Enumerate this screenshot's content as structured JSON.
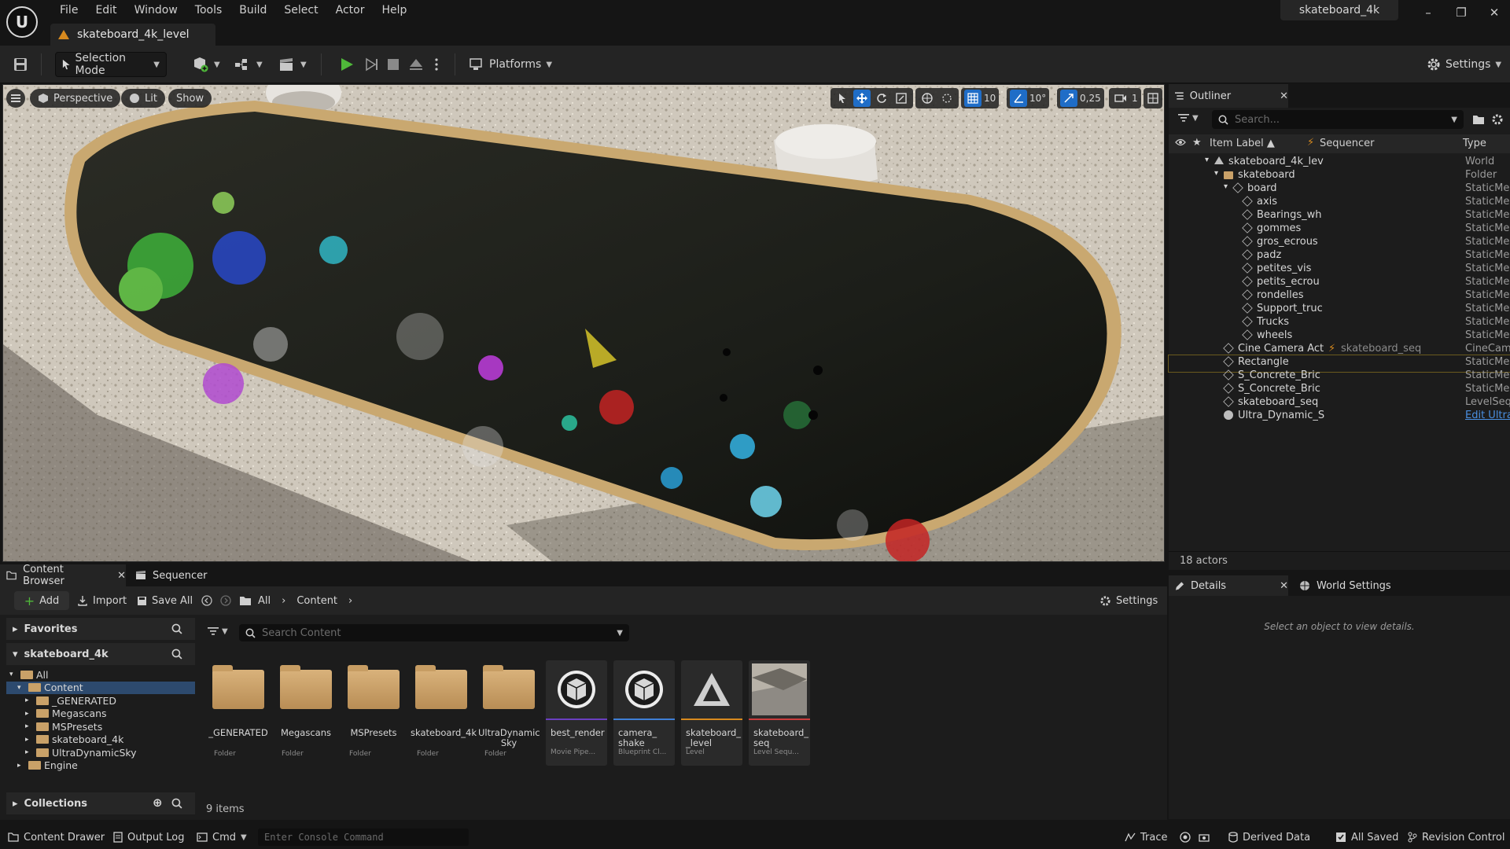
{
  "app": {
    "logo_letter": "U"
  },
  "menu": [
    "File",
    "Edit",
    "Window",
    "Tools",
    "Build",
    "Select",
    "Actor",
    "Help"
  ],
  "level_tab": "skateboard_4k_level",
  "project_name": "skateboard_4k",
  "window_controls": {
    "minimize": "–",
    "restore": "❐",
    "close": "✕"
  },
  "toolbar": {
    "selection_mode": "Selection Mode",
    "platforms": "Platforms",
    "settings": "Settings"
  },
  "viewport": {
    "perspective": "Perspective",
    "lit": "Lit",
    "show": "Show",
    "grid_snap": "10",
    "rotation_snap": "10°",
    "scale_snap": "0,25",
    "camera_speed": "1"
  },
  "outliner": {
    "tab": "Outliner",
    "search_placeholder": "Search...",
    "columns": {
      "label": "Item Label ▲",
      "sequencer": "Sequencer",
      "type": "Type"
    },
    "rows": [
      {
        "label": "skateboard_4k_lev",
        "type": "World",
        "depth": 0,
        "icon": "world"
      },
      {
        "label": "skateboard",
        "type": "Folder",
        "depth": 1,
        "icon": "folder"
      },
      {
        "label": "board",
        "type": "StaticMe",
        "depth": 2,
        "icon": "mesh"
      },
      {
        "label": "axis",
        "type": "StaticMe",
        "depth": 3,
        "icon": "mesh"
      },
      {
        "label": "Bearings_wh",
        "type": "StaticMe",
        "depth": 3,
        "icon": "mesh"
      },
      {
        "label": "gommes",
        "type": "StaticMe",
        "depth": 3,
        "icon": "mesh"
      },
      {
        "label": "gros_ecrous",
        "type": "StaticMe",
        "depth": 3,
        "icon": "mesh"
      },
      {
        "label": "padz",
        "type": "StaticMe",
        "depth": 3,
        "icon": "mesh"
      },
      {
        "label": "petites_vis",
        "type": "StaticMe",
        "depth": 3,
        "icon": "mesh"
      },
      {
        "label": "petits_ecrou",
        "type": "StaticMe",
        "depth": 3,
        "icon": "mesh"
      },
      {
        "label": "rondelles",
        "type": "StaticMe",
        "depth": 3,
        "icon": "mesh"
      },
      {
        "label": "Support_truc",
        "type": "StaticMe",
        "depth": 3,
        "icon": "mesh"
      },
      {
        "label": "Trucks",
        "type": "StaticMe",
        "depth": 3,
        "icon": "mesh"
      },
      {
        "label": "wheels",
        "type": "StaticMe",
        "depth": 3,
        "icon": "mesh"
      },
      {
        "label": "Cine Camera Act",
        "sequencer": "skateboard_seq",
        "type": "CineCam",
        "depth": 1,
        "icon": "camera"
      },
      {
        "label": "Rectangle",
        "type": "StaticMe",
        "depth": 1,
        "icon": "mesh",
        "selected": true
      },
      {
        "label": "S_Concrete_Bric",
        "type": "StaticMe",
        "depth": 1,
        "icon": "mesh"
      },
      {
        "label": "S_Concrete_Bric",
        "type": "StaticMe",
        "depth": 1,
        "icon": "mesh"
      },
      {
        "label": "skateboard_seq",
        "type": "LevelSeq",
        "depth": 1,
        "icon": "seq"
      },
      {
        "label": "Ultra_Dynamic_S",
        "type": "Edit Ultra",
        "depth": 1,
        "icon": "sky",
        "type_link": true
      }
    ],
    "actor_count": "18 actors"
  },
  "details": {
    "tab": "Details",
    "world_settings_tab": "World Settings",
    "empty_text": "Select an object to view details."
  },
  "content_browser": {
    "tab": "Content Browser",
    "sequencer_tab": "Sequencer",
    "add": "Add",
    "import": "Import",
    "save_all": "Save All",
    "breadcrumb": [
      "All",
      "Content"
    ],
    "settings": "Settings",
    "favorites": "Favorites",
    "project_root": "skateboard_4k",
    "tree": [
      {
        "label": "All",
        "depth": 0,
        "expanded": true
      },
      {
        "label": "Content",
        "depth": 1,
        "expanded": true,
        "selected": true
      },
      {
        "label": "_GENERATED",
        "depth": 2
      },
      {
        "label": "Megascans",
        "depth": 2
      },
      {
        "label": "MSPresets",
        "depth": 2
      },
      {
        "label": "skateboard_4k",
        "depth": 2
      },
      {
        "label": "UltraDynamicSky",
        "depth": 2
      },
      {
        "label": "Engine",
        "depth": 1
      }
    ],
    "collections": "Collections",
    "search_placeholder": "Search Content",
    "assets": [
      {
        "name": "_GENERATED",
        "kind": "Folder",
        "folder": true
      },
      {
        "name": "Megascans",
        "kind": "Folder",
        "folder": true
      },
      {
        "name": "MSPresets",
        "kind": "Folder",
        "folder": true
      },
      {
        "name": "skateboard_4k",
        "kind": "Folder",
        "folder": true
      },
      {
        "name": "UltraDynamic Sky",
        "kind": "Folder",
        "folder": true
      },
      {
        "name": "best_render",
        "kind": "Movie Pipe...",
        "bar": "#6a3fc0"
      },
      {
        "name": "camera_ shake",
        "kind": "Blueprint Cl...",
        "bar": "#3f7fd6"
      },
      {
        "name": "skateboard_ _level",
        "kind": "Level",
        "bar": "#d88a1e"
      },
      {
        "name": "skateboard_ seq",
        "kind": "Level Sequ...",
        "bar": "#c83d3d"
      }
    ],
    "item_count": "9 items"
  },
  "statusbar": {
    "content_drawer": "Content Drawer",
    "output_log": "Output Log",
    "cmd": "Cmd",
    "console_placeholder": "Enter Console Command",
    "trace": "Trace",
    "derived_data": "Derived Data",
    "all_saved": "All Saved",
    "revision_control": "Revision Control"
  },
  "colors": {
    "accent": "#1f6dc7",
    "play": "#4fb83a",
    "folder": "#c9a168"
  }
}
